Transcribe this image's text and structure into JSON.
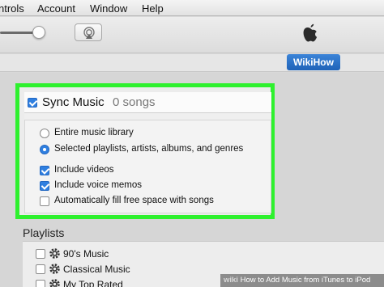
{
  "menubar": {
    "items": [
      "ntrols",
      "Account",
      "Window",
      "Help"
    ]
  },
  "toolbar": {
    "airplay_icon": "airplay-icon",
    "apple_icon": "apple-logo-icon"
  },
  "device": {
    "name": "WikiHow"
  },
  "sync": {
    "title": "Sync Music",
    "count": "0 songs",
    "checked": true,
    "options": {
      "entire_library": {
        "label": "Entire music library",
        "selected": false
      },
      "selected_playlists": {
        "label": "Selected playlists, artists, albums, and genres",
        "selected": true
      }
    },
    "checkboxes": [
      {
        "label": "Include videos",
        "checked": true
      },
      {
        "label": "Include voice memos",
        "checked": true
      },
      {
        "label": "Automatically fill free space with songs",
        "checked": false
      }
    ],
    "highlight_color": "#2ef12e"
  },
  "playlists": {
    "heading": "Playlists",
    "items": [
      {
        "name": "90's Music",
        "checked": false
      },
      {
        "name": "Classical Music",
        "checked": false
      },
      {
        "name": "My Top Rated",
        "checked": false
      }
    ]
  },
  "watermark": {
    "logo": "wiki",
    "text": "How to Add Music from iTunes to iPod"
  },
  "colors": {
    "accent": "#2f7fe0",
    "device_button": "#2a6fc8"
  }
}
